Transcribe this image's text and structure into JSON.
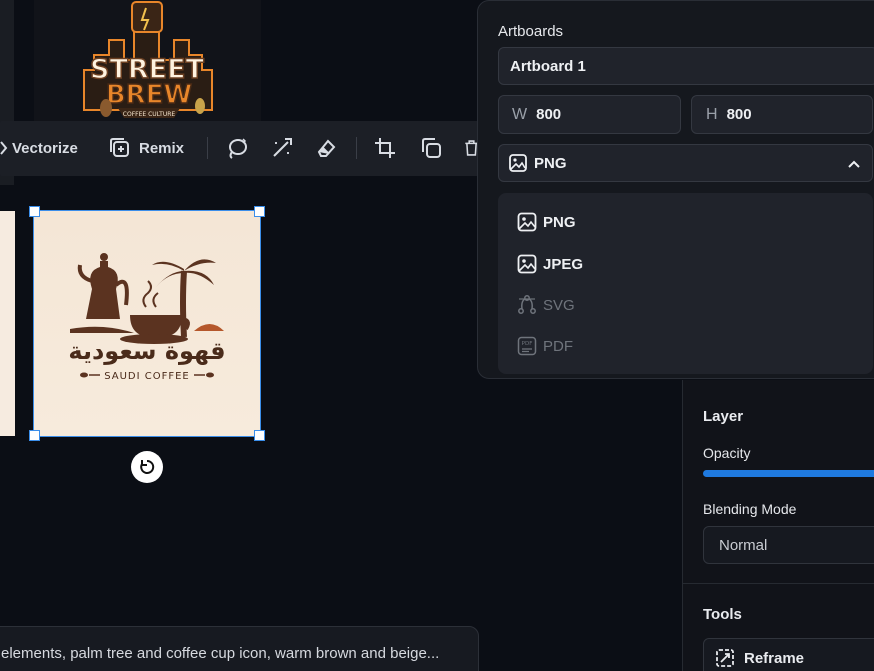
{
  "toolbar": {
    "vectorize_label": "Vectorize",
    "remix_label": "Remix"
  },
  "canvas": {
    "selected_artwork": {
      "arabic_text": "قهوة سعودية",
      "english_text": "SAUDI COFFEE"
    },
    "street_logo": {
      "line1": "STREET",
      "line2": "BREW",
      "tagline": "COFFEE CULTURE"
    }
  },
  "prompt": {
    "text": "elements, palm tree and coffee cup icon, warm brown and beige..."
  },
  "export_popover": {
    "section_label": "Artboards",
    "artboard_name": "Artboard 1",
    "width_prefix": "W",
    "width_value": "800",
    "height_prefix": "H",
    "height_value": "800",
    "format_selected": "PNG",
    "format_options": [
      {
        "label": "PNG",
        "enabled": true,
        "icon": "image-icon"
      },
      {
        "label": "JPEG",
        "enabled": true,
        "icon": "image-icon"
      },
      {
        "label": "SVG",
        "enabled": false,
        "icon": "vector-path-icon"
      },
      {
        "label": "PDF",
        "enabled": false,
        "icon": "pdf-file-icon"
      }
    ]
  },
  "layer_panel": {
    "title": "Layer",
    "opacity_label": "Opacity",
    "opacity_value": 1.0,
    "blend_label": "Blending Mode",
    "blend_value": "Normal",
    "tools_title": "Tools",
    "reframe_label": "Reframe"
  },
  "colors": {
    "accent": "#1f7ae0",
    "background": "#0b0e15",
    "panel": "#15181e",
    "logo_orange": "#e8862a",
    "logo_brown": "#6b3f21"
  }
}
